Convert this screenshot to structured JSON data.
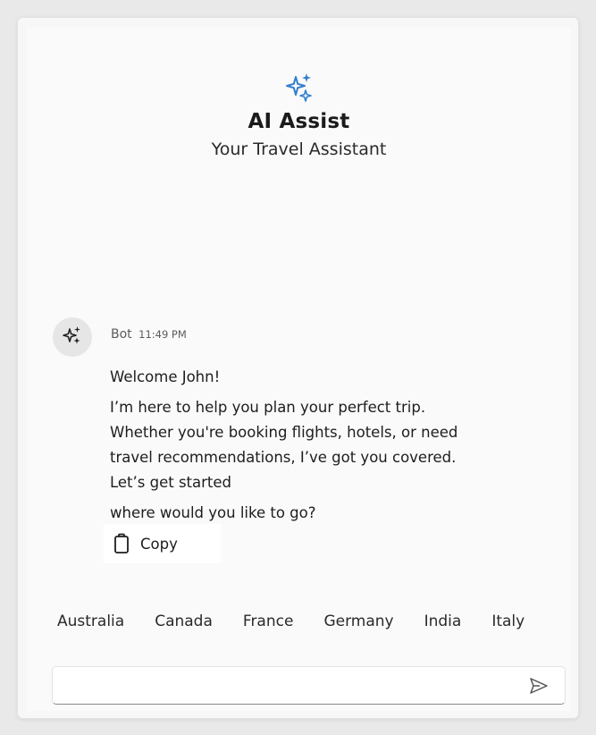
{
  "header": {
    "icon": "sparkle-icon",
    "title": "AI Assist",
    "subtitle": "Your Travel Assistant"
  },
  "message": {
    "avatar_icon": "sparkle-icon",
    "sender": "Bot",
    "time": "11:49 PM",
    "greeting": "Welcome John!",
    "body": "I’m here to help you plan your perfect trip. Whether you're booking flights, hotels, or need travel recommendations, I’ve got you covered. Let’s get started",
    "question": "where would you like to go?"
  },
  "copy": {
    "icon": "clipboard-icon",
    "label": "Copy"
  },
  "suggestions": [
    "Australia",
    "Canada",
    "France",
    "Germany",
    "India",
    "Italy"
  ],
  "input": {
    "value": "",
    "placeholder": "",
    "send_icon": "send-icon"
  },
  "colors": {
    "accent": "#2f7fd0",
    "background": "#fafafa"
  }
}
